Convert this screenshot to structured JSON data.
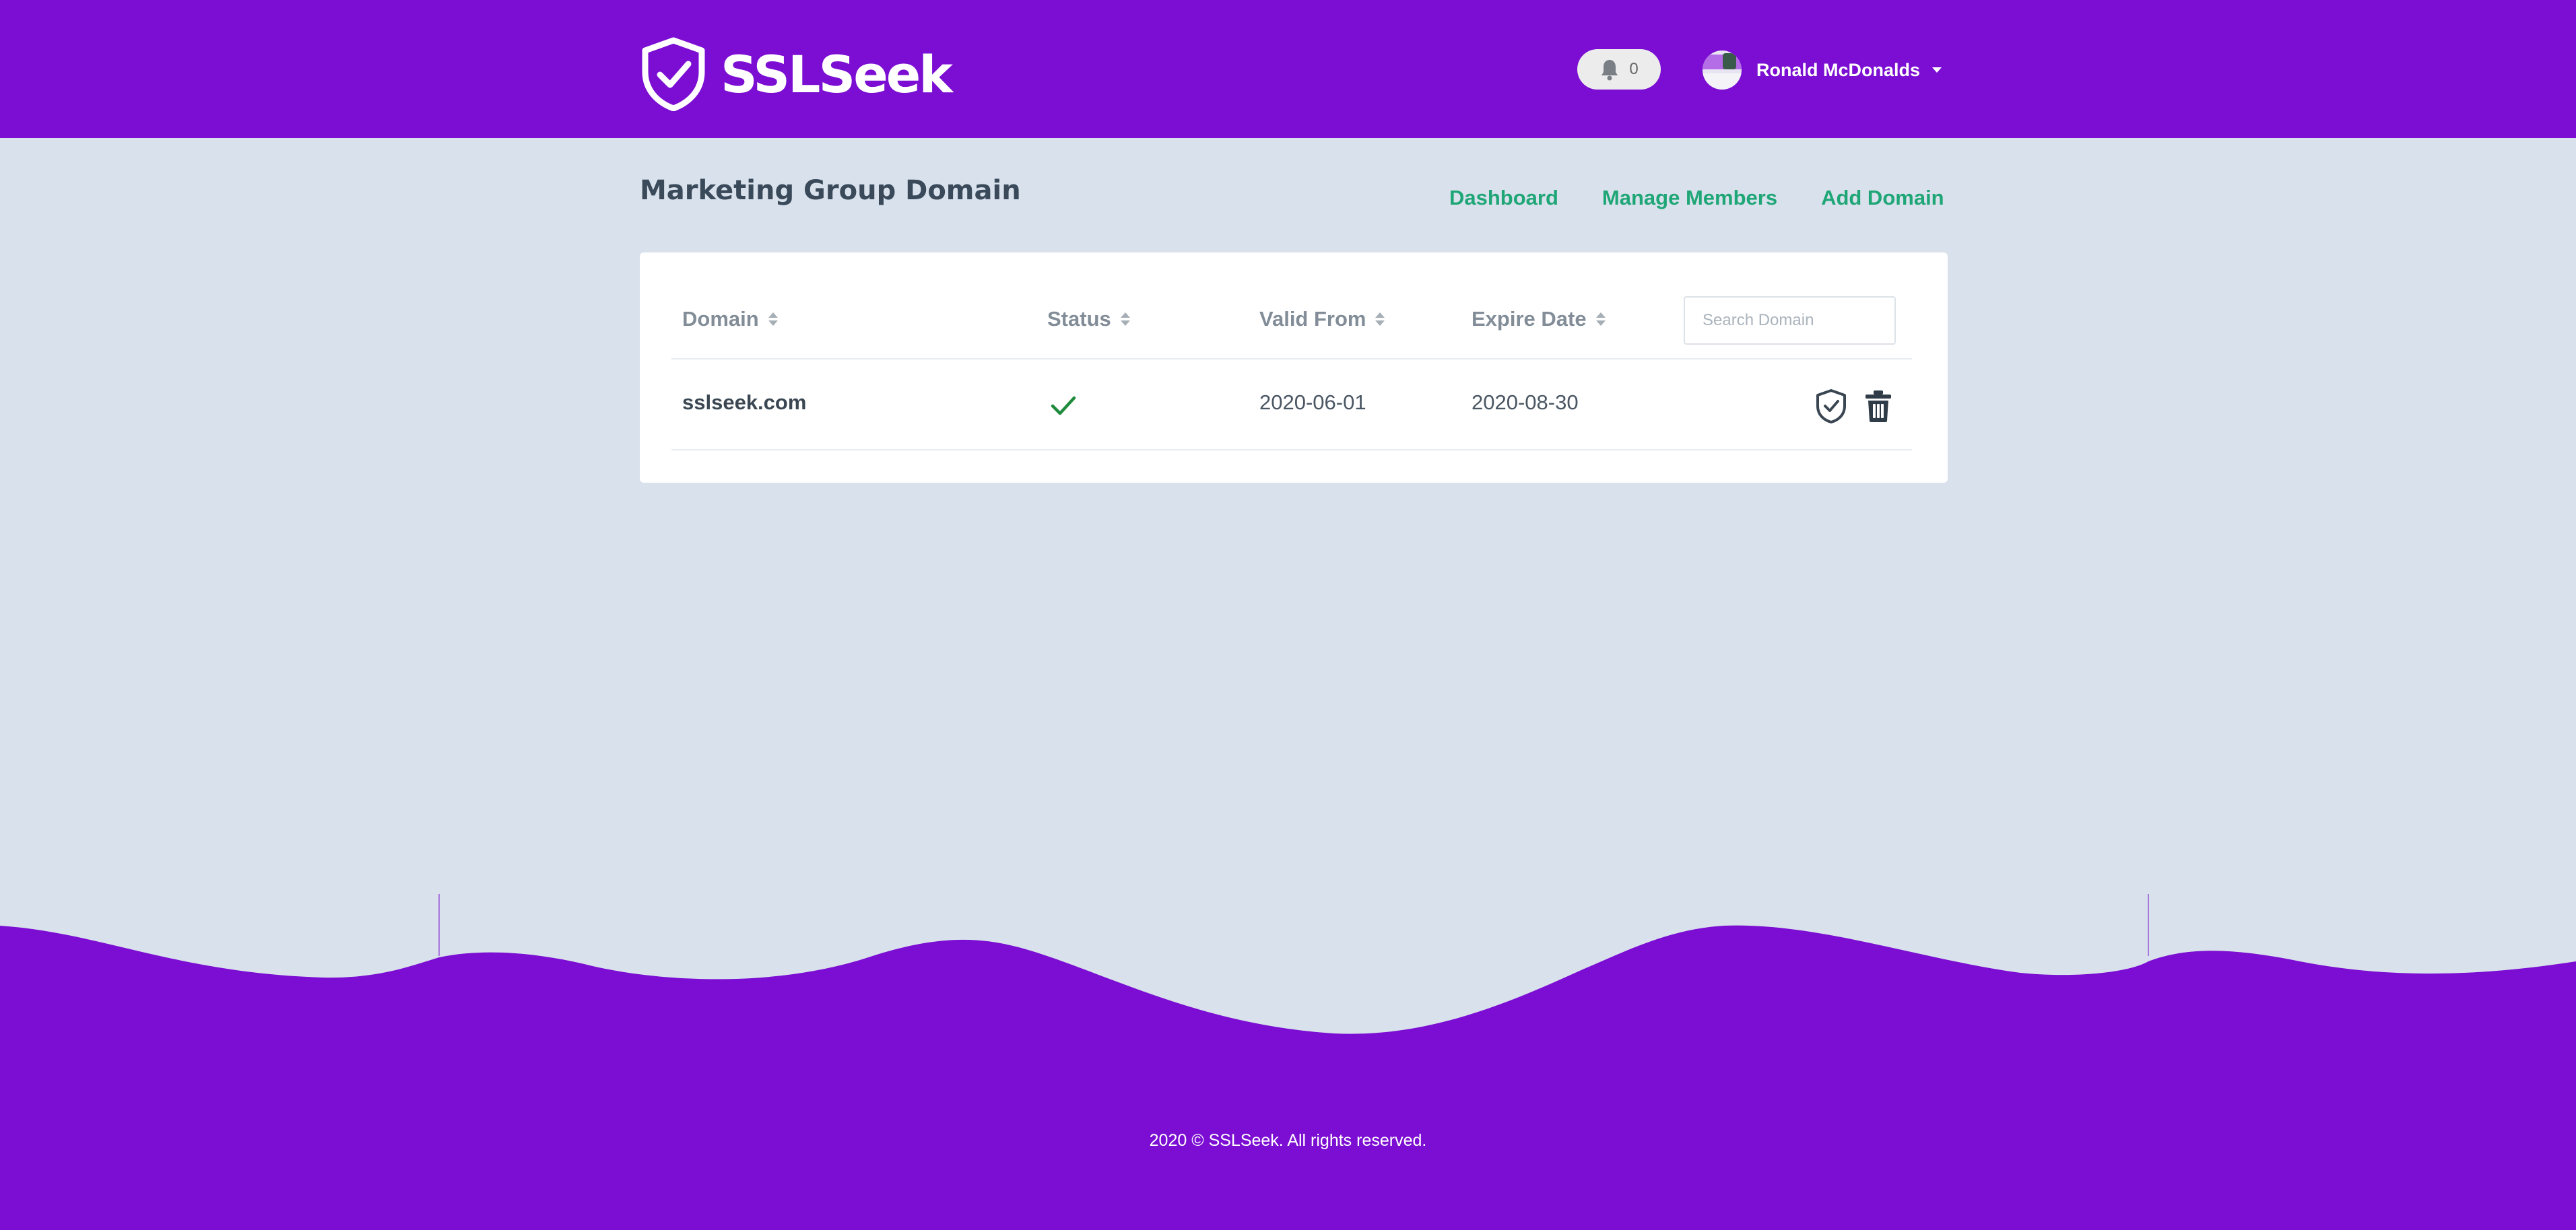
{
  "header": {
    "brand": "SSLSeek",
    "notifications": {
      "count": "0"
    },
    "user": {
      "name": "Ronald McDonalds"
    }
  },
  "page": {
    "title": "Marketing Group Domain",
    "nav": [
      "Dashboard",
      "Manage Members",
      "Add Domain"
    ]
  },
  "table": {
    "columns": [
      "Domain",
      "Status",
      "Valid From",
      "Expire Date"
    ],
    "search_placeholder": "Search Domain",
    "rows": [
      {
        "domain": "sslseek.com",
        "status": "valid",
        "valid_from": "2020-06-01",
        "expire_date": "2020-08-30"
      }
    ]
  },
  "footer": {
    "copyright": "2020 © SSLSeek. All rights reserved."
  },
  "colors": {
    "brand_purple": "#7b0ed2",
    "background": "#d9e1ec",
    "link_green": "#1fa676",
    "status_green": "#1e8a3c"
  },
  "icons": [
    "shield-check-logo-icon",
    "bell-icon",
    "caret-down-icon",
    "sort-icon",
    "check-icon",
    "shield-check-icon",
    "trash-icon"
  ]
}
